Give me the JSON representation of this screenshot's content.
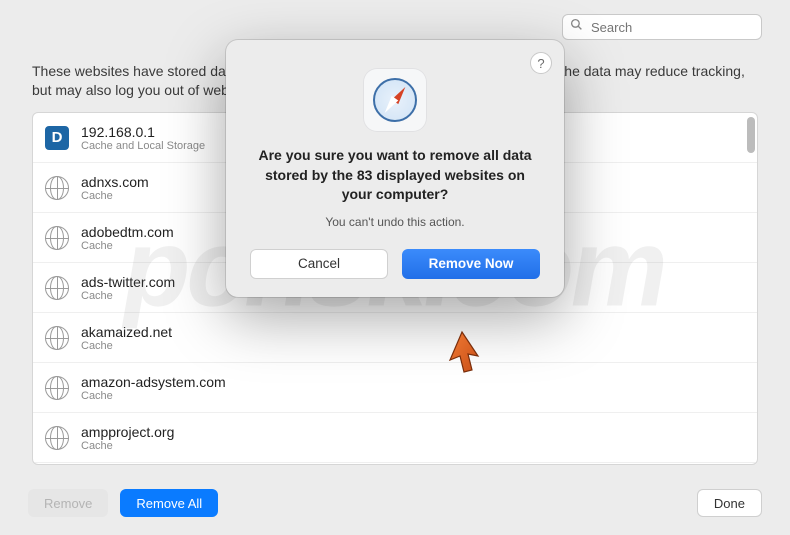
{
  "search": {
    "placeholder": "Search"
  },
  "description": "These websites have stored data that can be used to track your browsing. Removing the data may reduce tracking, but may also log you out of websites or change website behavior.",
  "sites": [
    {
      "host": "192.168.0.1",
      "detail": "Cache and Local Storage",
      "special_icon": "D"
    },
    {
      "host": "adnxs.com",
      "detail": "Cache"
    },
    {
      "host": "adobedtm.com",
      "detail": "Cache"
    },
    {
      "host": "ads-twitter.com",
      "detail": "Cache"
    },
    {
      "host": "akamaized.net",
      "detail": "Cache"
    },
    {
      "host": "amazon-adsystem.com",
      "detail": "Cache"
    },
    {
      "host": "ampproject.org",
      "detail": "Cache"
    }
  ],
  "buttons": {
    "remove": "Remove",
    "remove_all": "Remove All",
    "done": "Done"
  },
  "modal": {
    "title": "Are you sure you want to remove all data stored by the 83 displayed websites on your computer?",
    "subtitle": "You can't undo this action.",
    "cancel": "Cancel",
    "confirm": "Remove Now"
  },
  "watermark": "pcrisk.com"
}
